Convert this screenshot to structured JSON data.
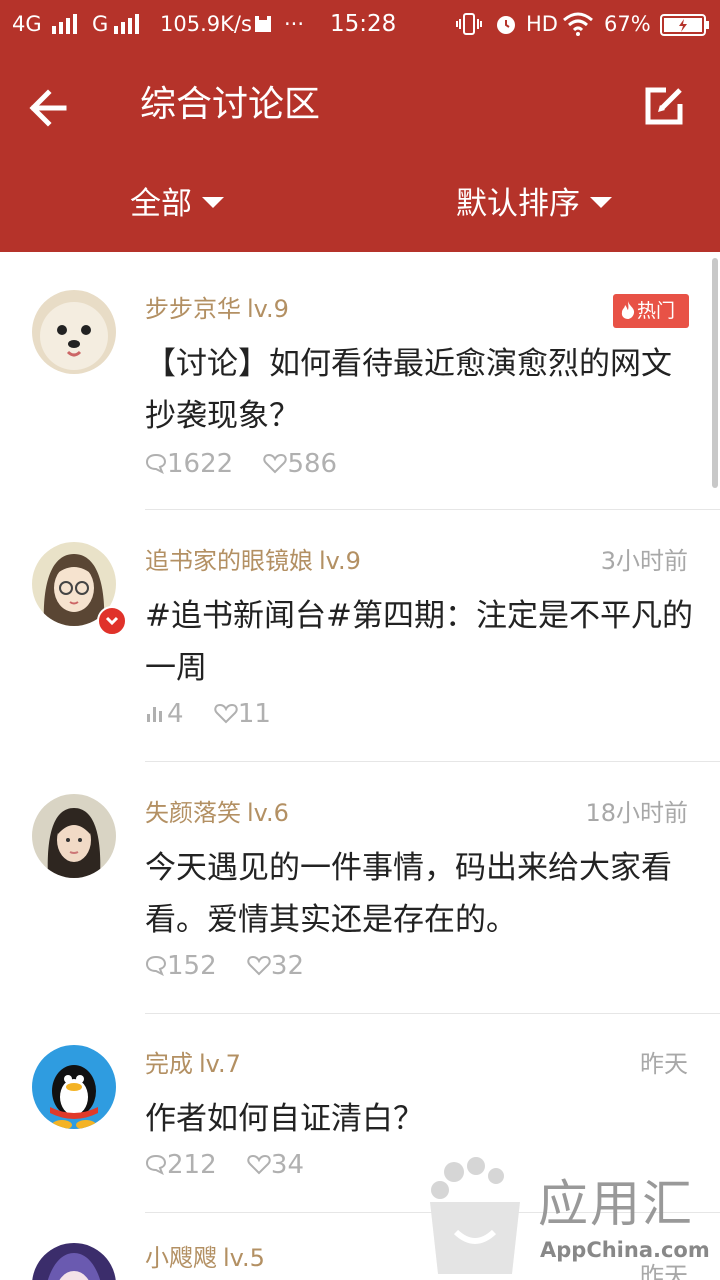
{
  "status_bar": {
    "network": "4G",
    "network2": "G",
    "speed": "105.9K/s",
    "dots": "···",
    "time": "15:28",
    "hd": "HD",
    "battery": "67%"
  },
  "header": {
    "title": "综合讨论区",
    "back_icon": "arrow-left-icon",
    "edit_icon": "edit-icon",
    "filter_left": "全部",
    "filter_right": "默认排序"
  },
  "posts": [
    {
      "username": "步步京华",
      "level": "lv.9",
      "tag": "热门",
      "title": "【讨论】如何看待最近愈演愈烈的网文抄袭现象？",
      "stat1_icon": "comment-icon",
      "stat1": "1622",
      "likes": "586"
    },
    {
      "username": "追书家的眼镜娘",
      "level": "lv.9",
      "time": "3小时前",
      "title": "#追书新闻台#第四期：注定是不平凡的一周",
      "stat1_icon": "poll-icon",
      "stat1": "4",
      "likes": "11"
    },
    {
      "username": "失颜落笑",
      "level": "lv.6",
      "time": "18小时前",
      "title": "今天遇见的一件事情，码出来给大家看看。爱情其实还是存在的。",
      "stat1_icon": "comment-icon",
      "stat1": "152",
      "likes": "32"
    },
    {
      "username": "完成",
      "level": "lv.7",
      "time": "昨天",
      "title": "作者如何自证清白？",
      "stat1_icon": "comment-icon",
      "stat1": "212",
      "likes": "34"
    },
    {
      "username": "小飕飕",
      "level": "lv.5",
      "time": "昨天"
    }
  ],
  "watermark": {
    "text": "应用汇",
    "url": "AppChina.com"
  },
  "colors": {
    "brand": "#b5332a",
    "username": "#b39063",
    "hot_tag": "#e85246"
  }
}
